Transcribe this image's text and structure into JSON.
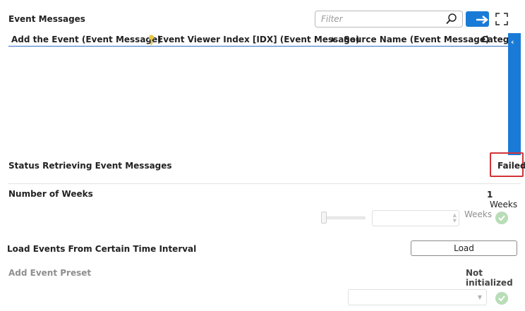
{
  "header": {
    "title": "Event Messages",
    "filter_placeholder": "Filter"
  },
  "grid": {
    "columns": [
      "Add the Event (Event Message)",
      "Event Viewer Index [IDX] (Event Message)",
      "Source Name (Event Message)",
      "Catego"
    ],
    "sort_indicator": "▲",
    "collapse_arrow": "‹"
  },
  "status": {
    "label": "Status Retrieving Event Messages",
    "value": "Failed"
  },
  "weeks": {
    "label": "Number of Weeks",
    "value": "1",
    "unit": "Weeks",
    "spin_unit": "Weeks"
  },
  "load_events": {
    "label": "Load Events From Certain Time Interval",
    "button": "Load"
  },
  "preset": {
    "label": "Add Event Preset",
    "value": "Not initialized"
  },
  "colors": {
    "accent": "#1a7bd7",
    "error_outline": "#d13438",
    "success_disabled": "#b8ddb8"
  }
}
